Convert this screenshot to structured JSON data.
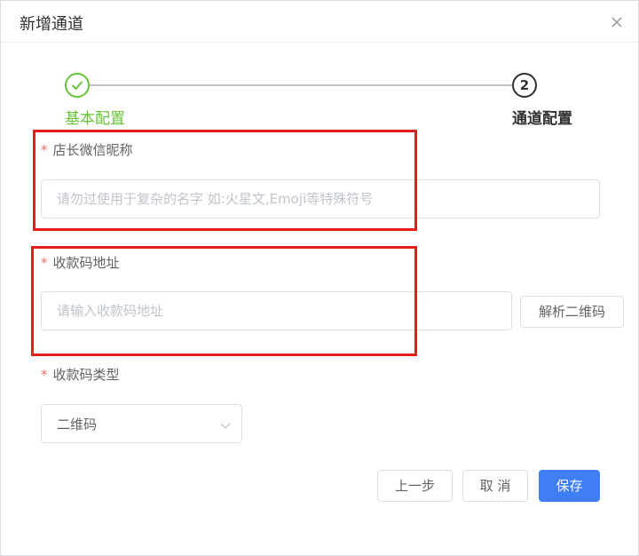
{
  "dialog": {
    "title": "新增通道",
    "close_icon": "close-icon"
  },
  "steps": [
    {
      "title": "基本配置",
      "status": "done",
      "icon": "check-icon",
      "color": "#67c23a"
    },
    {
      "title": "通道配置",
      "status": "current",
      "number": "2",
      "color": "#303133"
    }
  ],
  "form": {
    "required_mark": "*",
    "nickname": {
      "label": "店长微信昵称",
      "value": "",
      "placeholder": "请勿过使用于复杂的名字 如:火星文,Emoji等特殊符号"
    },
    "qrcode_url": {
      "label": "收款码地址",
      "value": "",
      "placeholder": "请输入收款码地址",
      "parse_button": "解析二维码"
    },
    "qrcode_type": {
      "label": "收款码类型",
      "selected": "二维码",
      "arrow_icon": "chevron-down-icon"
    }
  },
  "footer": {
    "prev_label": "上一步",
    "cancel_label": "取 消",
    "save_label": "保存"
  },
  "colors": {
    "accent": "#3f7ef4",
    "success": "#67c23a",
    "required": "#f56c6c",
    "highlight_box": "#e41d1d"
  }
}
